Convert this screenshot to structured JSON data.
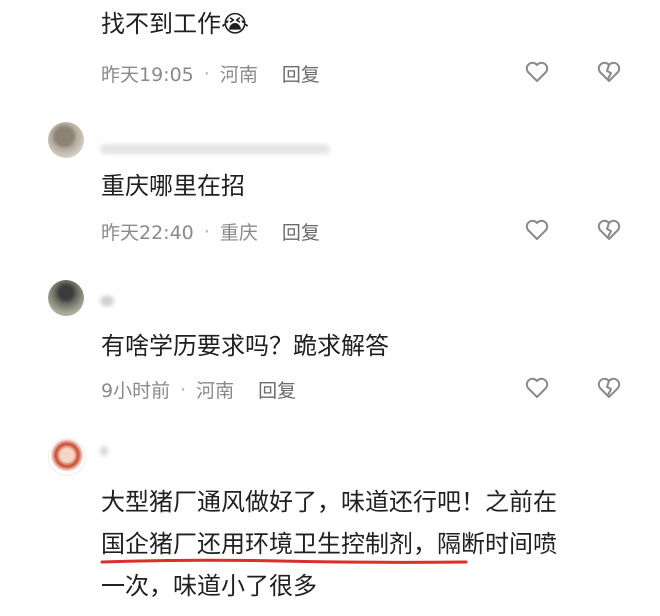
{
  "comments": [
    {
      "text": "找不到工作",
      "emoji": "😭",
      "time": "昨天19:05",
      "location": "河南",
      "reply_label": "回复"
    },
    {
      "text": "重庆哪里在招",
      "time": "昨天22:40",
      "location": "重庆",
      "reply_label": "回复"
    },
    {
      "text": "有啥学历要求吗？跪求解答",
      "time": "9小时前",
      "location": "河南",
      "reply_label": "回复"
    },
    {
      "lines": [
        "大型猪厂通风做好了，味道还行吧！之前在",
        "国企猪厂还用环境卫生控制剂，隔断时间喷",
        "一次，味道小了很多"
      ]
    }
  ],
  "colors": {
    "text": "#202020",
    "meta": "#8a8a8a",
    "icon": "#8a8a8a",
    "underline": "#d9302c"
  },
  "icons": [
    "like-heart-icon",
    "dislike-broken-heart-icon"
  ]
}
